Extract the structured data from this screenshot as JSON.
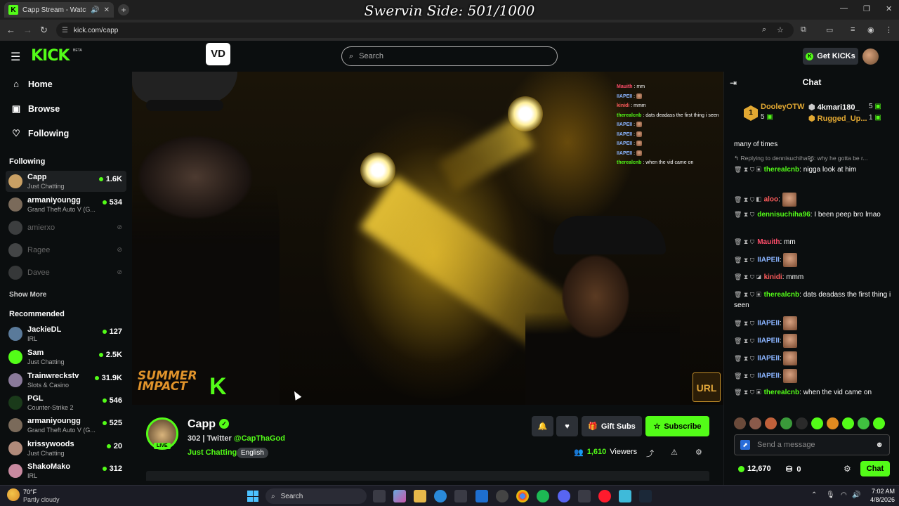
{
  "browser": {
    "tab_title": "Capp Stream - Watch Live o",
    "url": "kick.com/capp",
    "overlay_title": "Swervin Side: 501/1000"
  },
  "header": {
    "logo": "KICK",
    "logo_beta": "BETA",
    "vd_logo": "VD",
    "search_placeholder": "Search",
    "get_kicks_label": "Get KICKs"
  },
  "sidebar": {
    "nav": [
      {
        "label": "Home",
        "icon": "home-icon"
      },
      {
        "label": "Browse",
        "icon": "browse-icon"
      },
      {
        "label": "Following",
        "icon": "heart-icon"
      }
    ],
    "following_title": "Following",
    "following": [
      {
        "name": "Capp",
        "category": "Just Chatting",
        "viewers": "1.6K",
        "live": true,
        "color": "#c9a064"
      },
      {
        "name": "armaniyoungg",
        "category": "Grand Theft Auto V (G...",
        "viewers": "534",
        "live": true,
        "color": "#7a6a5a"
      },
      {
        "name": "amierxo",
        "live": false,
        "color": "#888"
      },
      {
        "name": "Ragee",
        "live": false,
        "color": "#999"
      },
      {
        "name": "Davee",
        "live": false,
        "color": "#777"
      }
    ],
    "show_more": "Show More",
    "recommended_title": "Recommended",
    "recommended": [
      {
        "name": "JackieDL",
        "category": "IRL",
        "viewers": "127",
        "color": "#5a7a9a"
      },
      {
        "name": "Sam",
        "category": "Just Chatting",
        "viewers": "2.5K",
        "color": "#53fc18"
      },
      {
        "name": "Trainwreckstv",
        "category": "Slots & Casino",
        "viewers": "31.9K",
        "color": "#8a7a9a"
      },
      {
        "name": "PGL",
        "category": "Counter-Strike 2",
        "viewers": "546",
        "color": "#1a3a1a"
      },
      {
        "name": "armaniyoungg",
        "category": "Grand Theft Auto V (G...",
        "viewers": "525",
        "color": "#7a6a5a"
      },
      {
        "name": "krissywoods",
        "category": "Just Chatting",
        "viewers": "20",
        "color": "#b08a7a"
      },
      {
        "name": "ShakoMako",
        "category": "IRL",
        "viewers": "312",
        "color": "#c98aa0"
      }
    ]
  },
  "video": {
    "stream_chat": [
      {
        "user": "Mauith",
        "text": "mm",
        "color": "#ff4d6a"
      },
      {
        "user": "IIAPEII",
        "text": "",
        "color": "#8ab4ff"
      },
      {
        "user": "kinidi",
        "text": "mmm",
        "color": "#ff5c5c"
      },
      {
        "user": "therealcnb",
        "text": "dats deadass the first thing i seen",
        "color": "#53fc18"
      },
      {
        "user": "IIAPEII",
        "text": "",
        "color": "#8ab4ff"
      },
      {
        "user": "IIAPEII",
        "text": "",
        "color": "#8ab4ff"
      },
      {
        "user": "IIAPEII",
        "text": "",
        "color": "#8ab4ff"
      },
      {
        "user": "IIAPEII",
        "text": "",
        "color": "#8ab4ff"
      },
      {
        "user": "therealcnb",
        "text": "when the vid came on",
        "color": "#53fc18"
      }
    ],
    "summer_logo_1": "SUMMER",
    "summer_logo_2": "IMPACT",
    "k_logo": "K",
    "url_logo": "URL"
  },
  "stream": {
    "streamer": "Capp",
    "live_label": "LIVE",
    "followers": "302",
    "twitter_prefix": "Twitter",
    "twitter_handle": "@CapThaGod",
    "category": "Just Chatting",
    "language": "English",
    "viewers": "1,610",
    "viewers_label": "Viewers",
    "gift_subs_label": "Gift Subs",
    "subscribe_label": "Subscribe"
  },
  "chat": {
    "title": "Chat",
    "leaderboard": {
      "top": {
        "name": "DooleyOTW",
        "value": "5",
        "rank": "1"
      },
      "second": {
        "name": "4kmari180_",
        "value": "5"
      },
      "third": {
        "name": "Rugged_Up...",
        "value": "1"
      }
    },
    "messages_head": "many of times",
    "reply_text": "Replying to dennisuchiha96: why he gotta be r...",
    "messages": [
      {
        "user": "therealcnb",
        "text": "nigga look at him",
        "color": "#53fc18"
      },
      {
        "user": "aloo",
        "text": "",
        "color": "#ff5c5c"
      },
      {
        "user": "dennisuchiha96",
        "text": "I been peep bro lmao",
        "color": "#53fc18"
      },
      {
        "user": "Mauith",
        "text": "mm",
        "color": "#ff4d6a"
      },
      {
        "user": "IIAPEII",
        "text": "",
        "color": "#8ab4ff"
      },
      {
        "user": "kinidi",
        "text": "mmm",
        "color": "#ff5c5c"
      },
      {
        "user": "therealcnb",
        "text": "dats deadass the first thing i seen",
        "color": "#53fc18"
      },
      {
        "user": "IIAPEII",
        "text": "",
        "color": "#8ab4ff"
      },
      {
        "user": "IIAPEII",
        "text": "",
        "color": "#8ab4ff"
      },
      {
        "user": "IIAPEII",
        "text": "",
        "color": "#8ab4ff"
      },
      {
        "user": "IIAPEII",
        "text": "",
        "color": "#8ab4ff"
      },
      {
        "user": "therealcnb",
        "text": "when the vid came on",
        "color": "#53fc18"
      }
    ],
    "input_placeholder": "Send a message",
    "kicks_balance": "12,670",
    "sub_balance": "0",
    "send_label": "Chat"
  },
  "taskbar": {
    "temperature": "70°F",
    "weather": "Partly cloudy",
    "search_placeholder": "Search",
    "time": "7:02 AM",
    "date": "4/8/2026"
  },
  "colors": {
    "brand": "#53fc18",
    "background": "#0b0e0f"
  }
}
